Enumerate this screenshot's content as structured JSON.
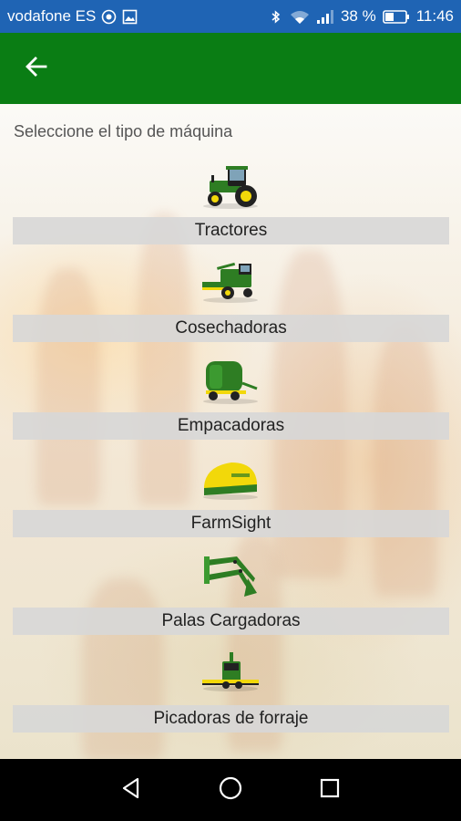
{
  "status_bar": {
    "carrier": "vodafone ES",
    "battery": "38 %",
    "time": "11:46",
    "icons": [
      "carrier-badge-icon",
      "image-notification-icon",
      "bluetooth-icon",
      "wifi-icon",
      "signal-icon",
      "battery-icon"
    ]
  },
  "app_bar": {
    "back_icon": "arrow-left-icon",
    "color": "#0a7d14"
  },
  "main": {
    "instruction": "Seleccione el tipo de máquina",
    "machines": [
      {
        "label": "Tractores",
        "icon": "tractor-icon"
      },
      {
        "label": "Cosechadoras",
        "icon": "combine-harvester-icon"
      },
      {
        "label": "Empacadoras",
        "icon": "baler-icon"
      },
      {
        "label": "FarmSight",
        "icon": "farmsight-receiver-icon"
      },
      {
        "label": "Palas Cargadoras",
        "icon": "front-loader-icon"
      },
      {
        "label": "Picadoras de forraje",
        "icon": "forage-harvester-icon"
      }
    ]
  },
  "nav_bar": {
    "buttons": [
      "back-triangle-icon",
      "home-circle-icon",
      "recents-square-icon"
    ]
  },
  "colors": {
    "status_bar": "#1f64b4",
    "app_bar": "#0a7d14",
    "label_bg": "#d7d7d7",
    "jd_green": "#2e7d23",
    "jd_yellow": "#f2d80a"
  }
}
